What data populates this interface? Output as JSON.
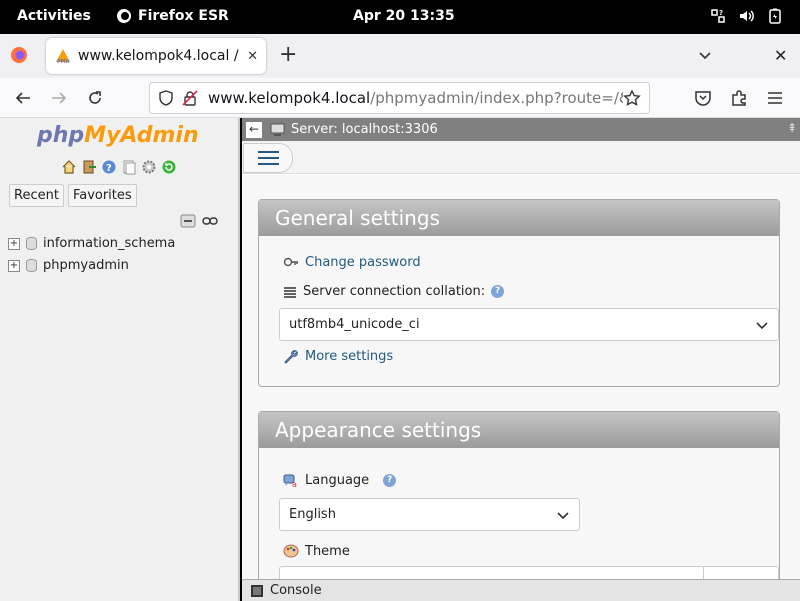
{
  "topbar": {
    "activities": "Activities",
    "app_name": "Firefox ESR",
    "clock": "Apr 20  13:35"
  },
  "browser": {
    "tab_title": "www.kelompok4.local / lo",
    "url_host": "www.kelompok4.local",
    "url_path": "/phpmyadmin/index.php?route=/&ro"
  },
  "pma_nav": {
    "logo_php": "php",
    "logo_myadmin": "MyAdmin",
    "tabs": [
      "Recent",
      "Favorites"
    ],
    "databases": [
      "information_schema",
      "phpmyadmin"
    ]
  },
  "main": {
    "server_label": "Server: localhost:3306",
    "general": {
      "title": "General settings",
      "change_password": "Change password",
      "collation_label": "Server connection collation:",
      "collation_value": "utf8mb4_unicode_ci",
      "more_settings": "More settings"
    },
    "appearance": {
      "title": "Appearance settings",
      "language_label": "Language",
      "language_value": "English",
      "theme_label": "Theme"
    },
    "console": "Console"
  }
}
